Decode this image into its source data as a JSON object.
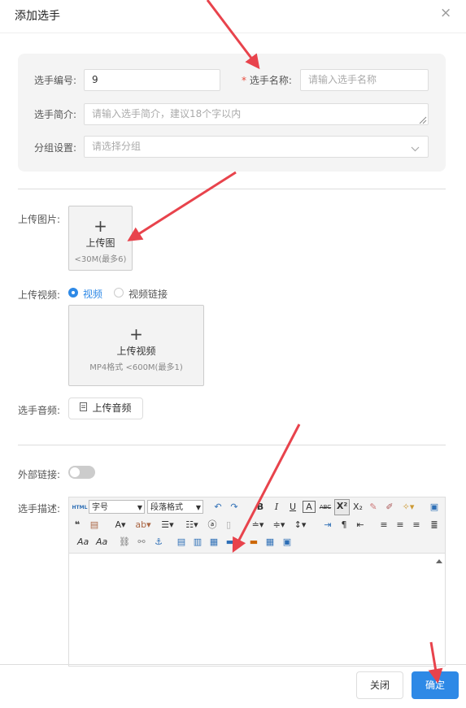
{
  "dialog": {
    "title": "添加选手",
    "close_glyph": "×"
  },
  "form": {
    "number_label": "选手编号:",
    "number_value": "9",
    "name_required_mark": "*",
    "name_label": "选手名称:",
    "name_placeholder": "请输入选手名称",
    "intro_label": "选手简介:",
    "intro_placeholder": "请输入选手简介，建议18个字以内",
    "group_label": "分组设置:",
    "group_placeholder": "请选择分组"
  },
  "image_upload": {
    "label": "上传图片:",
    "title": "上传图",
    "hint": "<30M(最多6)"
  },
  "video_upload": {
    "label": "上传视频:",
    "option_video": "视频",
    "option_link": "视频链接",
    "selected": "视频",
    "title": "上传视频",
    "hint": "MP4格式 <600M(最多1)"
  },
  "audio_upload": {
    "label": "选手音频:",
    "button": "上传音频"
  },
  "external_link": {
    "label": "外部链接:",
    "enabled": false
  },
  "description": {
    "label": "选手描述:",
    "font_size_select": "字号",
    "paragraph_select": "段落格式",
    "toolbar_html_label": "HTML",
    "bold": "B",
    "italic": "I",
    "underline": "U",
    "strike": "ABC",
    "font_color": "A"
  },
  "footer": {
    "close_button": "关闭",
    "confirm_button": "确定"
  },
  "colors": {
    "accent": "#2e89e6",
    "arrow": "#e8434c"
  }
}
